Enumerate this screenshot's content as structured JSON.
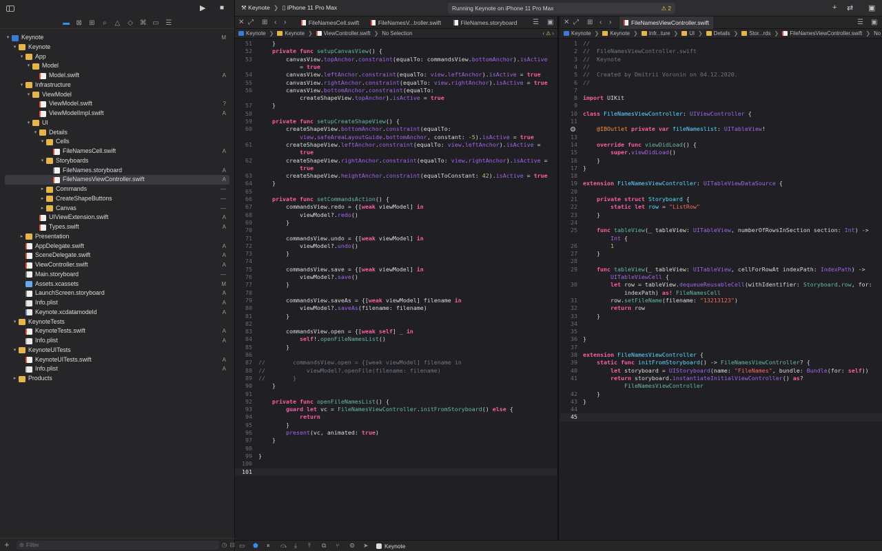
{
  "toolbar": {
    "scheme": "Keynote",
    "device": "iPhone 11 Pro Max",
    "activity": "Running Keynote on iPhone 11 Pro Max",
    "warnings": "2"
  },
  "navigator": {
    "filter_placeholder": "Filter",
    "rows": [
      {
        "label": "Keynote",
        "level": 0,
        "type": "proj",
        "disc": "open",
        "status": "M"
      },
      {
        "label": "Keynote",
        "level": 1,
        "type": "folder",
        "disc": "open",
        "status": ""
      },
      {
        "label": "App",
        "level": 2,
        "type": "folder",
        "disc": "open",
        "status": ""
      },
      {
        "label": "Model",
        "level": 3,
        "type": "folder",
        "disc": "open",
        "status": ""
      },
      {
        "label": "Model.swift",
        "level": 4,
        "type": "swift",
        "disc": "",
        "status": "A"
      },
      {
        "label": "Infrastructure",
        "level": 2,
        "type": "folder",
        "disc": "open",
        "status": ""
      },
      {
        "label": "ViewModel",
        "level": 3,
        "type": "folder",
        "disc": "open",
        "status": ""
      },
      {
        "label": "ViewModel.swift",
        "level": 4,
        "type": "swift",
        "disc": "",
        "status": "?"
      },
      {
        "label": "ViewModelImpl.swift",
        "level": 4,
        "type": "swift",
        "disc": "",
        "status": "A"
      },
      {
        "label": "UI",
        "level": 3,
        "type": "folder",
        "disc": "open",
        "status": ""
      },
      {
        "label": "Details",
        "level": 4,
        "type": "folder",
        "disc": "open",
        "status": ""
      },
      {
        "label": "Cells",
        "level": 5,
        "type": "folder",
        "disc": "open",
        "status": ""
      },
      {
        "label": "FileNamesCell.swift",
        "level": 6,
        "type": "swift",
        "disc": "",
        "status": "A"
      },
      {
        "label": "Storyboards",
        "level": 5,
        "type": "folder",
        "disc": "open",
        "status": ""
      },
      {
        "label": "FileNames.storyboard",
        "level": 6,
        "type": "sb",
        "disc": "",
        "status": "A"
      },
      {
        "label": "FileNamesViewController.swift",
        "level": 6,
        "type": "swift",
        "disc": "",
        "status": "A",
        "selected": true
      },
      {
        "label": "Commands",
        "level": 5,
        "type": "folder",
        "disc": "closed",
        "status": "—"
      },
      {
        "label": "CreateShapeButtons",
        "level": 5,
        "type": "folder",
        "disc": "closed",
        "status": "—"
      },
      {
        "label": "Canvas",
        "level": 5,
        "type": "folder",
        "disc": "closed",
        "status": "—"
      },
      {
        "label": "UIViewExtension.swift",
        "level": 4,
        "type": "swift",
        "disc": "",
        "status": "A"
      },
      {
        "label": "Types.swift",
        "level": 4,
        "type": "swift",
        "disc": "",
        "status": "A"
      },
      {
        "label": "Presentation",
        "level": 2,
        "type": "folder",
        "disc": "closed",
        "status": ""
      },
      {
        "label": "AppDelegate.swift",
        "level": 2,
        "type": "swift",
        "disc": "",
        "status": "A"
      },
      {
        "label": "SceneDelegate.swift",
        "level": 2,
        "type": "swift",
        "disc": "",
        "status": "A"
      },
      {
        "label": "ViewController.swift",
        "level": 2,
        "type": "swift",
        "disc": "",
        "status": "A"
      },
      {
        "label": "Main.storyboard",
        "level": 2,
        "type": "sb",
        "disc": "",
        "status": "—"
      },
      {
        "label": "Assets.xcassets",
        "level": 2,
        "type": "asset",
        "disc": "",
        "status": "M"
      },
      {
        "label": "LaunchScreen.storyboard",
        "level": 2,
        "type": "sb",
        "disc": "",
        "status": "A"
      },
      {
        "label": "Info.plist",
        "level": 2,
        "type": "plist",
        "disc": "",
        "status": "A"
      },
      {
        "label": "Keynote.xcdatamodeld",
        "level": 2,
        "type": "xcd",
        "disc": "",
        "status": "A"
      },
      {
        "label": "KeynoteTests",
        "level": 1,
        "type": "folder",
        "disc": "open",
        "status": ""
      },
      {
        "label": "KeynoteTests.swift",
        "level": 2,
        "type": "swift",
        "disc": "",
        "status": "A"
      },
      {
        "label": "Info.plist",
        "level": 2,
        "type": "plist",
        "disc": "",
        "status": "A"
      },
      {
        "label": "KeynoteUITests",
        "level": 1,
        "type": "folder",
        "disc": "open",
        "status": ""
      },
      {
        "label": "KeynoteUITests.swift",
        "level": 2,
        "type": "swift",
        "disc": "",
        "status": "A"
      },
      {
        "label": "Info.plist",
        "level": 2,
        "type": "plist",
        "disc": "",
        "status": "A"
      },
      {
        "label": "Products",
        "level": 1,
        "type": "folder",
        "disc": "closed",
        "status": ""
      }
    ]
  },
  "left_editor": {
    "tabs": [
      "FileNamesCell.swift",
      "FileNamesV...troller.swift",
      "FileNames.storyboard"
    ],
    "jumpbar": [
      "Keynote",
      "Keynote",
      "ViewController.swift",
      "No Selection"
    ],
    "lines": [
      {
        "n": "51",
        "c": "    }"
      },
      {
        "n": "52",
        "c": "    <k>private</k> <k>func</k> <f>setupCanvasView</f>() {"
      },
      {
        "n": "53",
        "c": "        canvasView.<p>topAnchor</p>.<p>constraint</p>(equalTo: commandsView.<p>bottomAnchor</p>).<p>isActive</p>"
      },
      {
        "n": "",
        "c": "            = <k>true</k>"
      },
      {
        "n": "54",
        "c": "        canvasView.<p>leftAnchor</p>.<p>constraint</p>(equalTo: <p>view</p>.<p>leftAnchor</p>).<p>isActive</p> = <k>true</k>"
      },
      {
        "n": "55",
        "c": "        canvasView.<p>rightAnchor</p>.<p>constraint</p>(equalTo: <p>view</p>.<p>rightAnchor</p>).<p>isActive</p> = <k>true</k>"
      },
      {
        "n": "56",
        "c": "        canvasView.<p>bottomAnchor</p>.<p>constraint</p>(equalTo:"
      },
      {
        "n": "",
        "c": "            createShapeView.<p>topAnchor</p>).<p>isActive</p> = <k>true</k>"
      },
      {
        "n": "57",
        "c": "    }"
      },
      {
        "n": "58",
        "c": ""
      },
      {
        "n": "59",
        "c": "    <k>private</k> <k>func</k> <f>setupCreateShapeView</f>() {"
      },
      {
        "n": "60",
        "c": "        createShapeView.<p>bottomAnchor</p>.<p>constraint</p>(equalTo:"
      },
      {
        "n": "",
        "c": "            <p>view</p>.<p>safeAreaLayoutGuide</p>.<p>bottomAnchor</p>, constant: <n>-5</n>).<p>isActive</p> = <k>true</k>"
      },
      {
        "n": "61",
        "c": "        createShapeView.<p>leftAnchor</p>.<p>constraint</p>(equalTo: <p>view</p>.<p>leftAnchor</p>).<p>isActive</p> ="
      },
      {
        "n": "",
        "c": "            <k>true</k>"
      },
      {
        "n": "62",
        "c": "        createShapeView.<p>rightAnchor</p>.<p>constraint</p>(equalTo: <p>view</p>.<p>rightAnchor</p>).<p>isActive</p> ="
      },
      {
        "n": "",
        "c": "            <k>true</k>"
      },
      {
        "n": "63",
        "c": "        createShapeView.<p>heightAnchor</p>.<p>constraint</p>(equalToConstant: <n>42</n>).<p>isActive</p> = <k>true</k>"
      },
      {
        "n": "64",
        "c": "    }"
      },
      {
        "n": "65",
        "c": ""
      },
      {
        "n": "66",
        "c": "    <k>private</k> <k>func</k> <f>setCommandsAction</f>() {"
      },
      {
        "n": "67",
        "c": "        commandsView.redo = {[<k>weak</k> viewModel] <k>in</k>"
      },
      {
        "n": "68",
        "c": "            viewModel?.<p>redo</p>()"
      },
      {
        "n": "69",
        "c": "        }"
      },
      {
        "n": "70",
        "c": ""
      },
      {
        "n": "71",
        "c": "        commandsView.undo = {[<k>weak</k> viewModel] <k>in</k>"
      },
      {
        "n": "72",
        "c": "            viewModel?.<p>undo</p>()"
      },
      {
        "n": "73",
        "c": "        }"
      },
      {
        "n": "74",
        "c": ""
      },
      {
        "n": "75",
        "c": "        commandsView.save = {[<k>weak</k> viewModel] <k>in</k>"
      },
      {
        "n": "76",
        "c": "            viewModel?.<p>save</p>()"
      },
      {
        "n": "77",
        "c": "        }"
      },
      {
        "n": "78",
        "c": ""
      },
      {
        "n": "79",
        "c": "        commandsView.saveAs = {[<k>weak</k> viewModel] filename <k>in</k>"
      },
      {
        "n": "80",
        "c": "            viewModel?.<p>saveAs</p>(filename: filename)"
      },
      {
        "n": "81",
        "c": "        }"
      },
      {
        "n": "82",
        "c": ""
      },
      {
        "n": "83",
        "c": "        commandsView.open = {[<k>weak</k> <k>self</k>] _ <k>in</k>"
      },
      {
        "n": "84",
        "c": "            <k>self</k>!.<f>openFileNamesList</f>()"
      },
      {
        "n": "85",
        "c": "        }"
      },
      {
        "n": "86",
        "c": ""
      },
      {
        "n": "87",
        "c": "<c>//        commandsView.open = {[weak viewModel] filename in</c>"
      },
      {
        "n": "88",
        "c": "<c>//            viewModel?.openFile(filename: filename)</c>"
      },
      {
        "n": "89",
        "c": "<c>//        }</c>"
      },
      {
        "n": "90",
        "c": "    }"
      },
      {
        "n": "91",
        "c": ""
      },
      {
        "n": "92",
        "c": "    <k>private</k> <k>func</k> <f>openFileNamesList</f>() {"
      },
      {
        "n": "93",
        "c": "        <k>guard</k> <k>let</k> vc = <f>FileNamesViewController</f>.<f>initFromStoryboard</f>() <k>else</k> {"
      },
      {
        "n": "94",
        "c": "            <k>return</k>"
      },
      {
        "n": "95",
        "c": "        }"
      },
      {
        "n": "96",
        "c": "        <p>present</p>(vc, animated: <k>true</k>)"
      },
      {
        "n": "97",
        "c": "    }"
      },
      {
        "n": "98",
        "c": ""
      },
      {
        "n": "99",
        "c": "}"
      },
      {
        "n": "100",
        "c": ""
      },
      {
        "n": "101",
        "c": "",
        "current": true
      }
    ]
  },
  "right_editor": {
    "tab": "FileNamesViewController.swift",
    "jumpbar": [
      "Keynote",
      "Keynote",
      "Infr...ture",
      "UI",
      "Details",
      "Stor...rds",
      "FileNamesViewController.swift",
      "No Selection"
    ],
    "lines": [
      {
        "n": "1",
        "c": "<c>//</c>"
      },
      {
        "n": "2",
        "c": "<c>//  FileNamesViewController.swift</c>"
      },
      {
        "n": "3",
        "c": "<c>//  Keynote</c>"
      },
      {
        "n": "4",
        "c": "<c>//</c>"
      },
      {
        "n": "5",
        "c": "<c>//  Created by Dmitrii Voronin on 04.12.2020.</c>"
      },
      {
        "n": "6",
        "c": "<c>//</c>"
      },
      {
        "n": "7",
        "c": ""
      },
      {
        "n": "8",
        "c": "<k>import</k> UIKit"
      },
      {
        "n": "9",
        "c": ""
      },
      {
        "n": "10",
        "c": "<k>class</k> <t>FileNamesViewController</t>: <p>UIViewController</p> {"
      },
      {
        "n": "11",
        "c": ""
      },
      {
        "n": "",
        "c": "    <a>@IBOutlet</a> <k>private</k> <k>var</k> <t>fileNameslist</t>: <p>UITableView</p>!",
        "bp": true
      },
      {
        "n": "13",
        "c": ""
      },
      {
        "n": "14",
        "c": "    <k>override</k> <k>func</k> <f>viewDidLoad</f>() {"
      },
      {
        "n": "15",
        "c": "        <k>super</k>.<p>viewDidLoad</p>()"
      },
      {
        "n": "16",
        "c": "    }"
      },
      {
        "n": "17",
        "c": "}"
      },
      {
        "n": "18",
        "c": ""
      },
      {
        "n": "19",
        "c": "<k>extension</k> <t>FileNamesViewController</t>: <p>UITableViewDataSource</p> {"
      },
      {
        "n": "20",
        "c": ""
      },
      {
        "n": "21",
        "c": "    <k>private</k> <k>struct</k> <t>Storyboard</t> {"
      },
      {
        "n": "22",
        "c": "        <k>static</k> <k>let</k> <t>row</t> = <s>\"ListRow\"</s>"
      },
      {
        "n": "23",
        "c": "    }"
      },
      {
        "n": "24",
        "c": ""
      },
      {
        "n": "25",
        "c": "    <k>func</k> <f>tableView</f>(_ tableView: <p>UITableView</p>, numberOfRowsInSection section: <p>Int</p>) ->"
      },
      {
        "n": "",
        "c": "        <p>Int</p> {"
      },
      {
        "n": "26",
        "c": "        <n>1</n>"
      },
      {
        "n": "27",
        "c": "    }"
      },
      {
        "n": "28",
        "c": ""
      },
      {
        "n": "29",
        "c": "    <k>func</k> <f>tableView</f>(_ tableView: <p>UITableView</p>, cellForRowAt indexPath: <p>IndexPath</p>) ->"
      },
      {
        "n": "",
        "c": "        <p>UITableViewCell</p> {"
      },
      {
        "n": "30",
        "c": "        <k>let</k> row = tableView.<p>dequeueReusableCell</p>(withIdentifier: <f>Storyboard</f>.<f>row</f>, for:"
      },
      {
        "n": "",
        "c": "            indexPath) <k>as!</k> <f>FileNamesCell</f>"
      },
      {
        "n": "31",
        "c": "        row.<f>setFileName</f>(filename: <s>\"13213123\"</s>)"
      },
      {
        "n": "32",
        "c": "        <k>return</k> row"
      },
      {
        "n": "33",
        "c": "    }"
      },
      {
        "n": "34",
        "c": ""
      },
      {
        "n": "35",
        "c": ""
      },
      {
        "n": "36",
        "c": "}"
      },
      {
        "n": "37",
        "c": ""
      },
      {
        "n": "38",
        "c": "<k>extension</k> <t>FileNamesViewController</t> {"
      },
      {
        "n": "39",
        "c": "    <k>static</k> <k>func</k> <t>initFromStoryboard</t>() -> <f>FileNamesViewController</f>? {"
      },
      {
        "n": "40",
        "c": "        <k>let</k> storyboard = <p>UIStoryboard</p>(name: <s>\"FileNames\"</s>, bundle: <p>Bundle</p>(for: <k>self</k>))"
      },
      {
        "n": "41",
        "c": "        <k>return</k> storyboard.<p>instantiateInitialViewController</p>() <k>as</k>?"
      },
      {
        "n": "",
        "c": "            <f>FileNamesViewController</f>"
      },
      {
        "n": "42",
        "c": "    }"
      },
      {
        "n": "43",
        "c": "}"
      },
      {
        "n": "44",
        "c": ""
      },
      {
        "n": "45",
        "c": "",
        "current": true
      }
    ]
  },
  "debug": {
    "target": "Keynote"
  }
}
